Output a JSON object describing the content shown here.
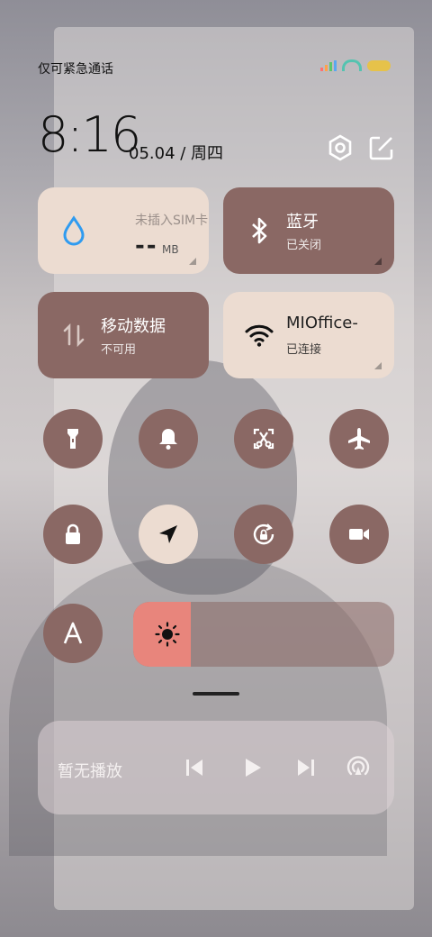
{
  "status_bar": {
    "carrier_text": "仅可紧急通话",
    "icons": [
      "signal-icon",
      "wifi-icon",
      "battery-icon"
    ]
  },
  "clock": {
    "time": "8:16",
    "date": "05.04 / 周四"
  },
  "header_icons": [
    "settings-icon",
    "edit-icon"
  ],
  "tiles": {
    "data_usage": {
      "label": "未插入SIM卡",
      "value": "--",
      "unit": "MB"
    },
    "bluetooth": {
      "label": "蓝牙",
      "status": "已关闭"
    },
    "mobile_data": {
      "label": "移动数据",
      "status": "不可用"
    },
    "wifi": {
      "label": "MIOffice-",
      "status": "已连接"
    }
  },
  "toggles": [
    {
      "name": "flashlight",
      "on": false
    },
    {
      "name": "silent-bell",
      "on": false
    },
    {
      "name": "screenshot",
      "on": false
    },
    {
      "name": "airplane-mode",
      "on": false
    },
    {
      "name": "lock-screen",
      "on": false
    },
    {
      "name": "location",
      "on": true
    },
    {
      "name": "auto-rotate",
      "on": false
    },
    {
      "name": "screen-record",
      "on": false
    },
    {
      "name": "font-size",
      "on": false
    }
  ],
  "brightness": {
    "level": 0.22
  },
  "media": {
    "label": "暂无播放"
  },
  "colors": {
    "tile_light": "#ecdcd1",
    "tile_dark": "#8a6864",
    "brightness_accent": "#e8857c",
    "wifi_blue": "#2f9bf0"
  }
}
